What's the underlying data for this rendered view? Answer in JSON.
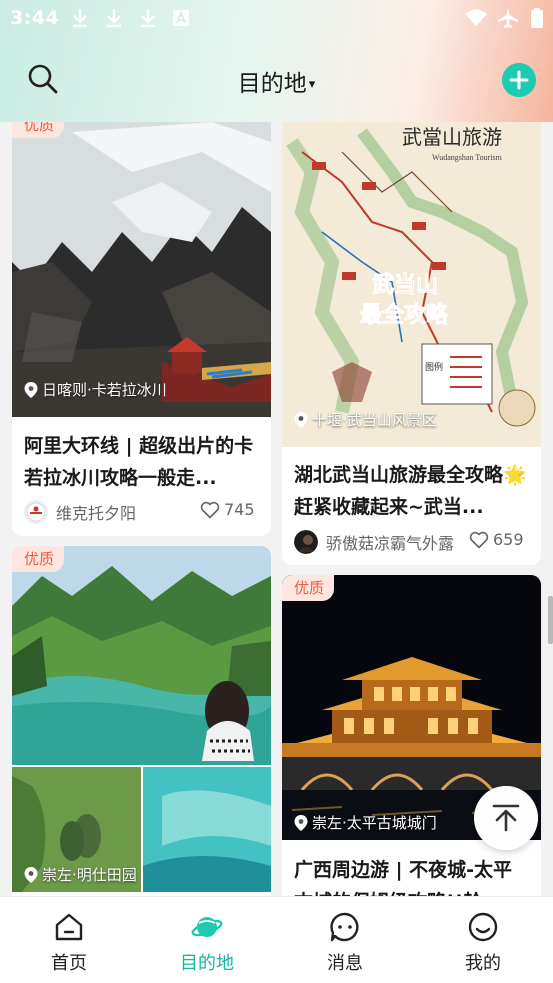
{
  "status_bar": {
    "time": "3:44"
  },
  "header": {
    "title": "目的地",
    "caret": "▾"
  },
  "colors": {
    "accent": "#1ecbb0",
    "badge_bg": "#fde6e0",
    "badge_text": "#ee5b3e"
  },
  "cards": [
    {
      "badge": "优质",
      "location": "日喀则·卡若拉冰川",
      "title": "阿里大环线 | 超级出片的卡若拉冰川攻略一般走...",
      "author": "维克托夕阳",
      "likes": "745"
    },
    {
      "badge": "",
      "location": "十堰·武当山风景区",
      "title": "湖北武当山旅游最全攻略🌟赶紧收藏起来~武当...",
      "author": "骄傲菇凉霸气外露",
      "likes": "659",
      "map_title": "武當山旅游",
      "map_subtitle": "Wudangshan Tourism",
      "map_overlay_line1": "武当山",
      "map_overlay_line2": "最全攻略",
      "map_legend": "图例"
    },
    {
      "badge": "优质",
      "location": "崇左·明仕田园",
      "title": ""
    },
    {
      "badge": "优质",
      "location": "崇左·太平古城城门",
      "title": "广西周边游 | 不夜城-太平古城的保姆级攻略!!耠..."
    }
  ],
  "bottom_nav": [
    {
      "label": "首页",
      "icon": "home-icon",
      "active": false
    },
    {
      "label": "目的地",
      "icon": "planet-icon",
      "active": true
    },
    {
      "label": "消息",
      "icon": "message-icon",
      "active": false
    },
    {
      "label": "我的",
      "icon": "profile-icon",
      "active": false
    }
  ]
}
